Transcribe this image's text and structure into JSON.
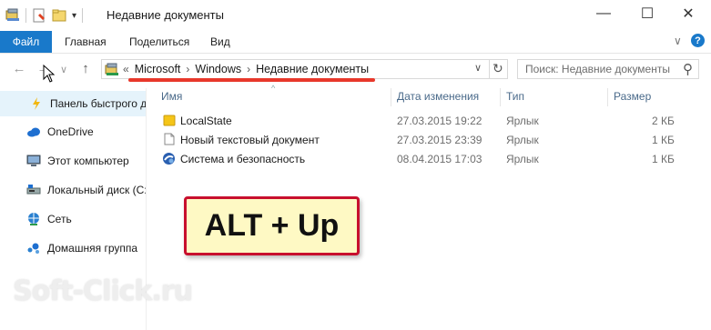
{
  "window": {
    "title": "Недавние документы",
    "controls": {
      "minimize": "—",
      "maximize": "☐",
      "close": "✕"
    }
  },
  "ribbon": {
    "file_tab": "Файл",
    "tabs": [
      "Главная",
      "Поделиться",
      "Вид"
    ],
    "expand_glyph": "∨",
    "help_glyph": "?"
  },
  "navigation": {
    "back_glyph": "←",
    "forward_glyph": "→",
    "recent_glyph": "∨",
    "up_glyph": "↑",
    "address_overflow": "«",
    "breadcrumbs": [
      "Microsoft",
      "Windows",
      "Недавние документы"
    ],
    "dropdown_glyph": "∨",
    "refresh_glyph": "↻",
    "search_placeholder": "Поиск: Недавние документы",
    "search_glyph": "⚲"
  },
  "sidebar": {
    "items": [
      {
        "label": "Панель быстрого доступа",
        "icon": "star-pin-icon",
        "selected": true
      },
      {
        "label": "OneDrive",
        "icon": "cloud-icon",
        "selected": false
      },
      {
        "label": "Этот компьютер",
        "icon": "computer-icon",
        "selected": false
      },
      {
        "label": "Локальный диск (C:)",
        "icon": "drive-icon",
        "selected": false
      },
      {
        "label": "Сеть",
        "icon": "network-icon",
        "selected": false
      },
      {
        "label": "Домашняя группа",
        "icon": "homegroup-icon",
        "selected": false
      }
    ]
  },
  "file_list": {
    "sort_glyph": "^",
    "columns": [
      "Имя",
      "Дата изменения",
      "Тип",
      "Размер"
    ],
    "rows": [
      {
        "name": "LocalState",
        "date": "27.03.2015 19:22",
        "type": "Ярлык",
        "size": "2 КБ",
        "icon": "folder-shortcut-icon"
      },
      {
        "name": "Новый текстовый документ",
        "date": "27.03.2015 23:39",
        "type": "Ярлык",
        "size": "1 КБ",
        "icon": "text-document-icon"
      },
      {
        "name": "Система и безопасность",
        "date": "08.04.2015 17:03",
        "type": "Ярлык",
        "size": "1 КБ",
        "icon": "control-panel-icon"
      }
    ]
  },
  "callout": {
    "text": "ALT + Up"
  },
  "watermark": {
    "text": "Soft-Click.ru"
  },
  "colors": {
    "file_tab": "#1979ca",
    "selection": "#e5f3fb",
    "callout_bg": "#fef9c4",
    "callout_border": "#c8102e",
    "underline": "#e8382b"
  }
}
